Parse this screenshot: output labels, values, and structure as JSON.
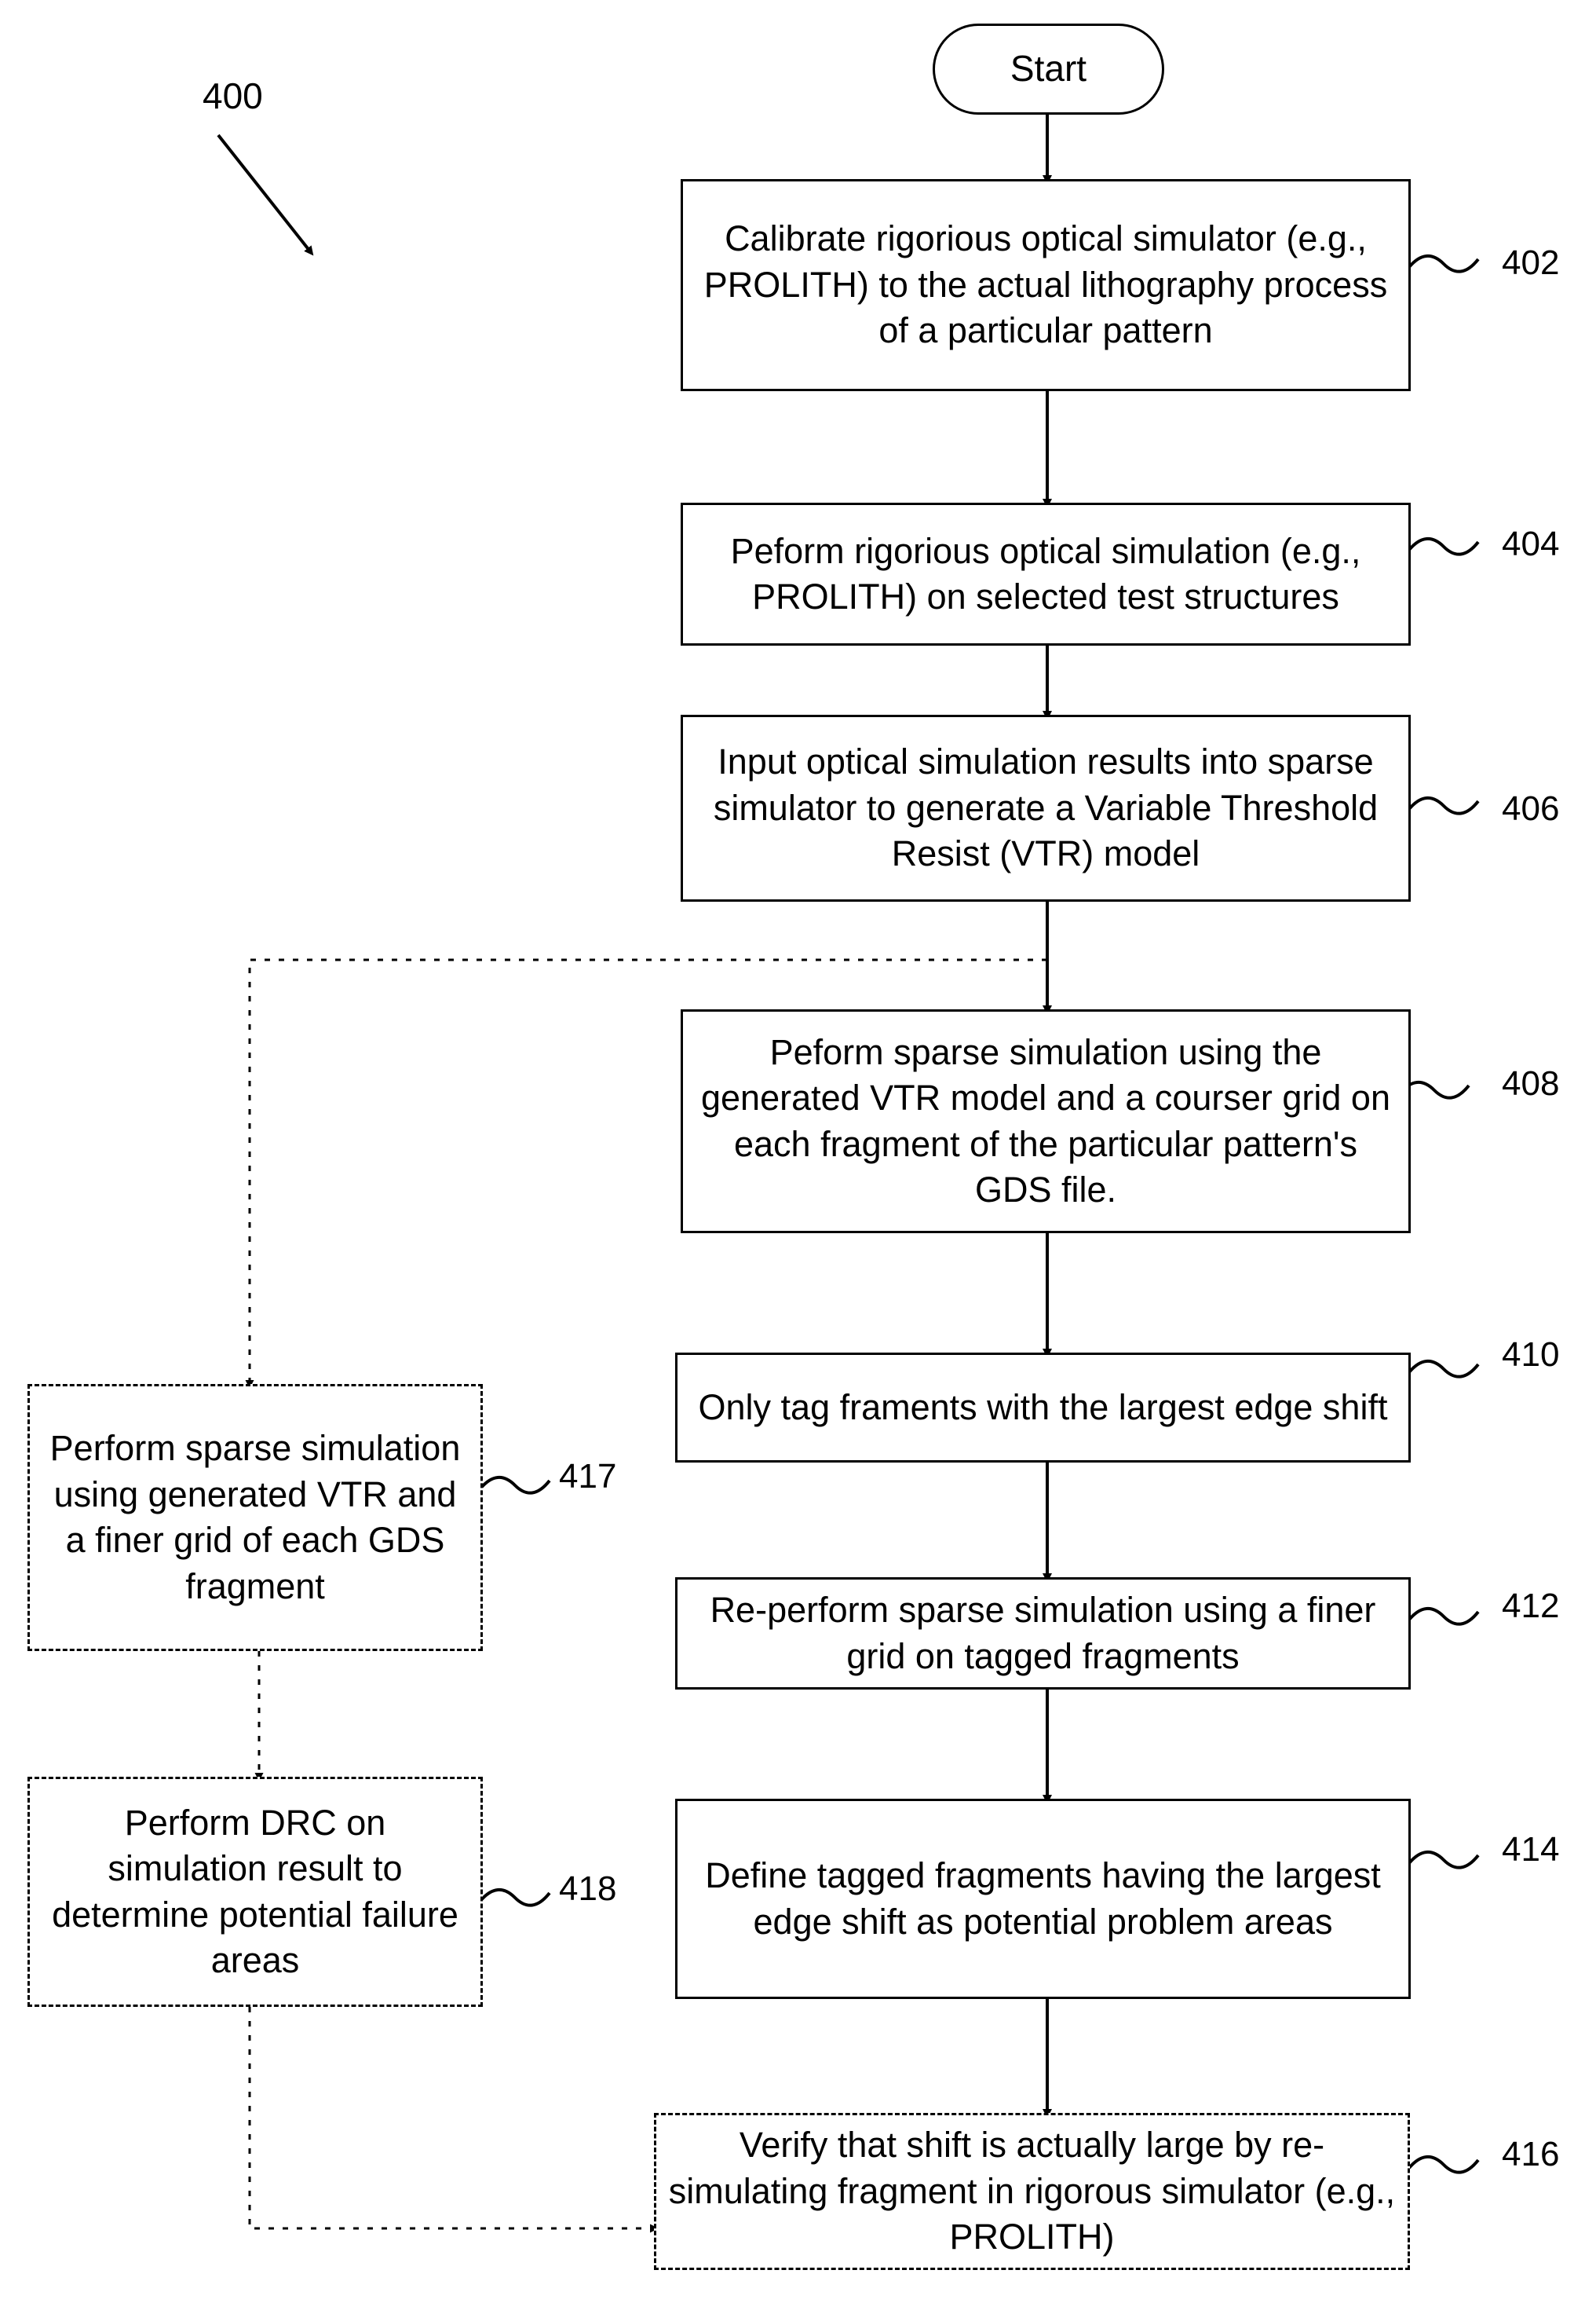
{
  "figure": {
    "number": "400",
    "title_text": "400"
  },
  "nodes": [
    {
      "id": "start",
      "label": "Start",
      "ref": "",
      "shape": "terminal"
    },
    {
      "id": "step402",
      "label": "Calibrate rigorious optical simulator (e.g., PROLITH) to the actual lithography process of a particular pattern",
      "ref": "402",
      "shape": "solid-box"
    },
    {
      "id": "step404",
      "label": "Peform rigorious optical simulation (e.g., PROLITH) on selected test structures",
      "ref": "404",
      "shape": "solid-box"
    },
    {
      "id": "step406",
      "label": "Input optical simulation results into sparse simulator to generate a Variable Threshold Resist (VTR) model",
      "ref": "406",
      "shape": "solid-box"
    },
    {
      "id": "step408",
      "label": "Peform sparse simulation using the generated VTR model and a courser grid on each fragment of the particular pattern's GDS file.",
      "ref": "408",
      "shape": "solid-box"
    },
    {
      "id": "step410",
      "label": "Only tag framents with the largest edge shift",
      "ref": "410",
      "shape": "solid-box"
    },
    {
      "id": "step412",
      "label": "Re-perform sparse simulation using a finer grid on tagged fragments",
      "ref": "412",
      "shape": "solid-box"
    },
    {
      "id": "step414",
      "label": "Define tagged fragments having the largest edge shift as potential problem areas",
      "ref": "414",
      "shape": "solid-box"
    },
    {
      "id": "step416",
      "label": "Verify that shift is actually large by re-simulating fragment in rigorous simulator (e.g., PROLITH)",
      "ref": "416",
      "shape": "dashed-box"
    },
    {
      "id": "step417",
      "label": "Perform sparse simulation using generated VTR and a finer grid of each GDS fragment",
      "ref": "417",
      "shape": "dashed-box"
    },
    {
      "id": "step418",
      "label": "Perform DRC on simulation result to determine potential failure areas",
      "ref": "418",
      "shape": "dashed-box"
    }
  ],
  "labels": {
    "start": "Start",
    "step402": "Calibrate rigorious optical simulator (e.g., PROLITH) to the actual lithography process of a particular pattern",
    "step404": "Peform rigorious optical simulation (e.g., PROLITH) on selected test structures",
    "step406": "Input optical simulation results into sparse simulator to generate a Variable Threshold Resist (VTR) model",
    "step408": "Peform sparse simulation using the generated VTR model and a courser grid on each fragment of the particular pattern's GDS file.",
    "step410": "Only tag framents with the largest edge shift",
    "step412": "Re-perform sparse simulation using a finer grid on tagged fragments",
    "step414": "Define tagged fragments having the largest edge shift as potential problem areas",
    "step416": "Verify that shift is actually large by re-simulating fragment in rigorous simulator (e.g., PROLITH)",
    "step417": "Perform sparse simulation using generated VTR and a finer grid of each GDS fragment",
    "step418": "Perform DRC on simulation result to determine potential failure areas"
  },
  "refs": {
    "fig": "400",
    "r402": "402",
    "r404": "404",
    "r406": "406",
    "r408": "408",
    "r410": "410",
    "r412": "412",
    "r414": "414",
    "r416": "416",
    "r417": "417",
    "r418": "418"
  },
  "colors": {
    "stroke": "#000000",
    "background": "#ffffff"
  }
}
